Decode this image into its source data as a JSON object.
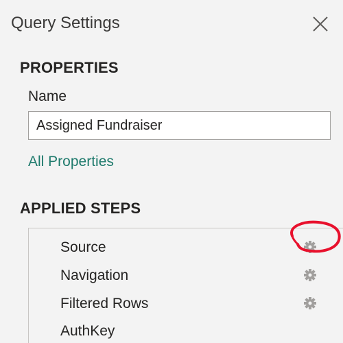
{
  "panel": {
    "title": "Query Settings"
  },
  "properties": {
    "header": "PROPERTIES",
    "name_label": "Name",
    "name_value": "Assigned Fundraiser",
    "all_properties_link": "All Properties"
  },
  "applied_steps": {
    "header": "APPLIED STEPS",
    "steps": [
      {
        "label": "Source",
        "has_settings": true,
        "settings_icon": "gear-icon"
      },
      {
        "label": "Navigation",
        "has_settings": true,
        "settings_icon": "gear-icon"
      },
      {
        "label": "Filtered Rows",
        "has_settings": true,
        "settings_icon": "gear-icon"
      },
      {
        "label": "AuthKey",
        "has_settings": false
      }
    ]
  },
  "icons": {
    "close": "close-icon",
    "collapse": "collapse-triangle-icon"
  },
  "colors": {
    "link": "#1e7a6c",
    "annotation": "#e8112d",
    "gear": "#a19f9d"
  }
}
